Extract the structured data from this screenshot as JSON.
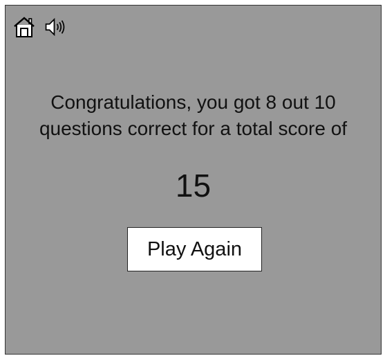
{
  "toolbar": {
    "home_icon": "home-icon",
    "sound_icon": "speaker-volume-icon"
  },
  "result": {
    "message_line1": "Congratulations, you got 8 out 10",
    "message_line2": "questions correct for a total score of",
    "score": "15"
  },
  "actions": {
    "play_again_label": "Play Again"
  },
  "colors": {
    "panel_background": "#999999",
    "button_background": "#ffffff",
    "text": "#111111"
  }
}
